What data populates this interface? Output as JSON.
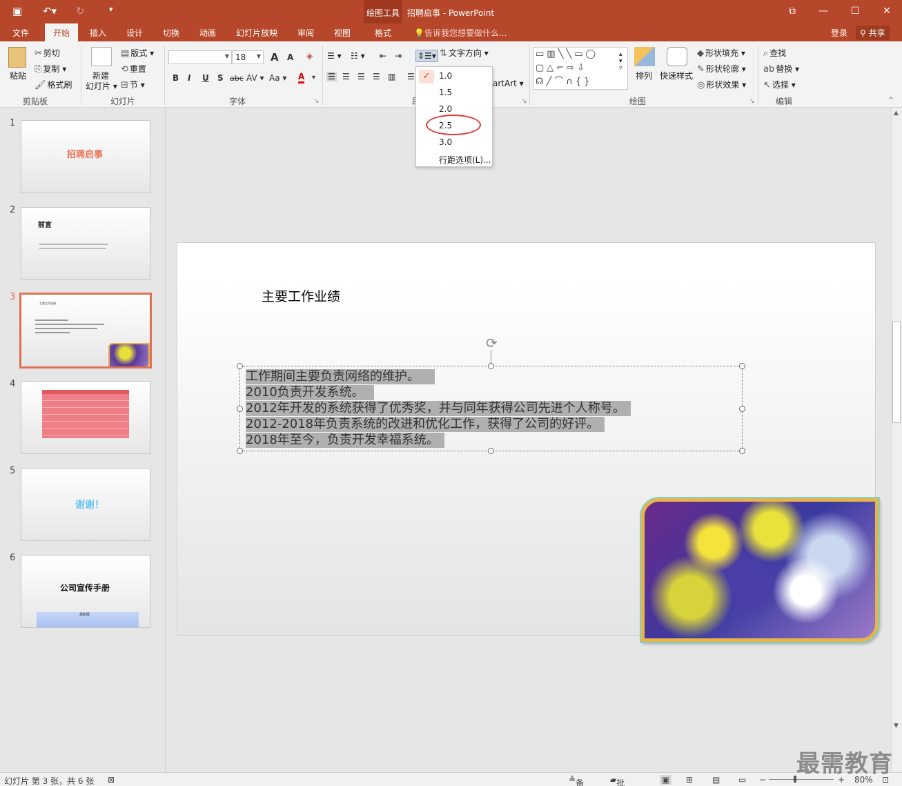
{
  "app": {
    "title": "招聘启事 - PowerPoint",
    "context_tab_group": "绘图工具",
    "theme_color": "#b7472a"
  },
  "tabs": [
    "文件",
    "开始",
    "插入",
    "设计",
    "切换",
    "动画",
    "幻灯片放映",
    "审阅",
    "视图",
    "格式"
  ],
  "active_tab": "开始",
  "tell_me": "告诉我您想要做什么...",
  "login": "登录",
  "share": "共享",
  "ribbon": {
    "clipboard": {
      "paste": "粘贴",
      "cut": "剪切",
      "copy": "复制",
      "format_painter": "格式刷",
      "group": "剪贴板"
    },
    "slides": {
      "new_slide_1": "新建",
      "new_slide_2": "幻灯片",
      "layout": "版式",
      "reset": "重置",
      "section": "节",
      "group": "幻灯片"
    },
    "font": {
      "size": "18",
      "bold": "B",
      "italic": "I",
      "underline": "U",
      "shadow": "S",
      "strike": "abc",
      "spacing": "AV",
      "case": "Aa",
      "color": "A",
      "grow": "A",
      "shrink": "A",
      "group": "字体"
    },
    "paragraph": {
      "text_direction": "文字方向",
      "smartart": "artArt",
      "group_prefix": "段"
    },
    "drawing": {
      "arrange": "排列",
      "quick_styles": "快速样式",
      "shape_fill": "形状填充",
      "shape_outline": "形状轮廓",
      "shape_effects": "形状效果",
      "group": "绘图"
    },
    "editing": {
      "find": "查找",
      "replace": "替换",
      "select": "选择",
      "group": "编辑"
    }
  },
  "line_spacing_menu": {
    "items": [
      "1.0",
      "1.5",
      "2.0",
      "2.5",
      "3.0"
    ],
    "checked": "1.0",
    "highlighted": "2.5",
    "options": "行距选项(L)..."
  },
  "thumbnails": [
    {
      "num": "1",
      "title": "招聘启事"
    },
    {
      "num": "2",
      "title": "前言"
    },
    {
      "num": "3",
      "title": "主要工作业绩",
      "selected": true
    },
    {
      "num": "4",
      "title": ""
    },
    {
      "num": "5",
      "title": "谢谢！"
    },
    {
      "num": "6",
      "title": "公司宣传手册",
      "caption": "最新版"
    }
  ],
  "slide": {
    "title": "主要工作业绩",
    "lines": [
      "工作期间主要负责网络的维护。",
      "2010负责开发系统。",
      "2012年开发的系统获得了优秀奖，并与同年获得公司先进个人称号。",
      "2012-2018年负责系统的改进和优化工作，获得了公司的好评。",
      "2018年至今，负责开发幸福系统。"
    ]
  },
  "status": {
    "slide_info": "幻灯片 第 3 张，共 6 张",
    "notes": "备注",
    "comments": "批注",
    "zoom": "80%"
  },
  "watermark": "最需教育"
}
